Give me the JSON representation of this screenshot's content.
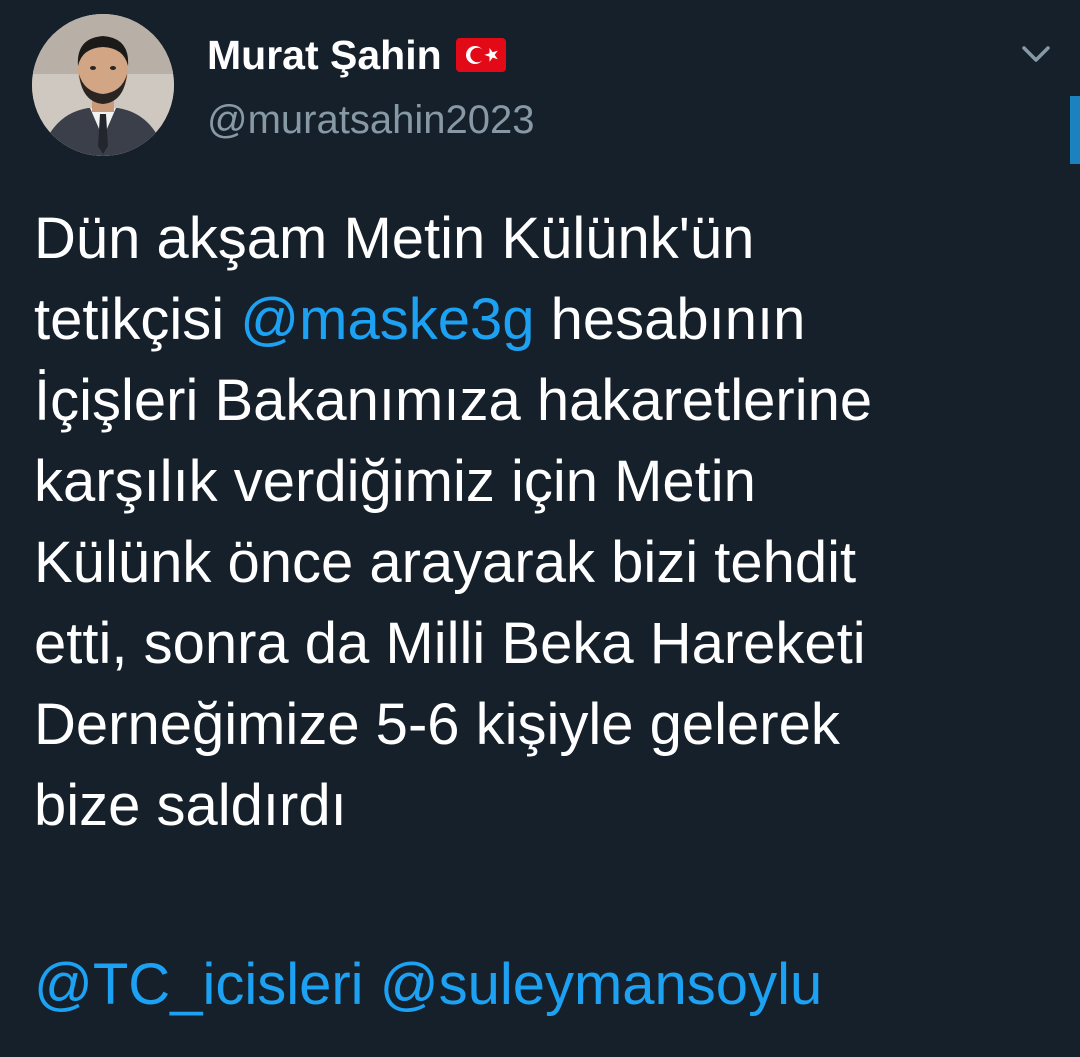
{
  "author": {
    "display_name": "Murat Şahin",
    "handle": "@muratsahin2023",
    "flag": "turkey-flag"
  },
  "tweet": {
    "lines": [
      [
        "Dün akşam Metin Külünk'ün"
      ],
      [
        "tetikçisi ",
        "@maske3g",
        " hesabının"
      ],
      [
        "İçişleri Bakanımıza hakaretlerine"
      ],
      [
        "karşılık verdiğimiz için Metin"
      ],
      [
        "Külünk önce arayarak bizi tehdit"
      ],
      [
        "etti, sonra da Milli Beka Hareketi"
      ],
      [
        "Derneğimize 5-6 kişiyle gelerek"
      ],
      [
        "bize saldırdı"
      ]
    ],
    "mentions": [
      "@TC_icisleri",
      "@suleymansoylu"
    ]
  },
  "colors": {
    "background": "#15202b",
    "text": "#ffffff",
    "secondary": "#8899a6",
    "accent": "#1da1f2",
    "flag_red": "#e30a17"
  },
  "icons": {
    "more": "chevron-down-icon"
  }
}
